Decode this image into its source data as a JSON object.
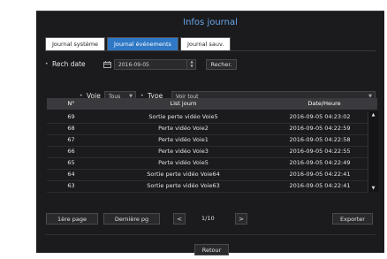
{
  "window": {
    "title": "Infos journal"
  },
  "tabs": [
    {
      "label": "Journal système",
      "active": false
    },
    {
      "label": "Journal événements",
      "active": true
    },
    {
      "label": "Journal sauv.",
      "active": false
    }
  ],
  "search": {
    "label": "Rech date",
    "date_value": "2016-09-05",
    "button_label": "Recher."
  },
  "filters": {
    "channel_label": "Voie",
    "channel_value": "Tous",
    "type_label": "Type",
    "type_value": "Voir tout"
  },
  "table": {
    "columns": [
      "N°",
      "List journ",
      "Date/Heure"
    ],
    "rows": [
      {
        "no": "69",
        "event": "Sortie perte vidéo Voie5",
        "datetime": "2016-09-05 04:23:02"
      },
      {
        "no": "68",
        "event": "Perte vidéo Voie2",
        "datetime": "2016-09-05 04:22:59"
      },
      {
        "no": "67",
        "event": "Perte vidéo Voie1",
        "datetime": "2016-09-05 04:22:58"
      },
      {
        "no": "66",
        "event": "Perte vidéo Voie3",
        "datetime": "2016-09-05 04:22:55"
      },
      {
        "no": "65",
        "event": "Perte vidéo Voie5",
        "datetime": "2016-09-05 04:22:49"
      },
      {
        "no": "64",
        "event": "Sortie perte vidéo Voie64",
        "datetime": "2016-09-05 04:22:41"
      },
      {
        "no": "63",
        "event": "Sortie perte vidéo Voie63",
        "datetime": "2016-09-05 04:22:41"
      }
    ]
  },
  "pager": {
    "first_label": "1ère page",
    "last_label": "Dernière pg",
    "page_indicator": "1/10",
    "export_label": "Exporter"
  },
  "footer": {
    "return_label": "Retour"
  },
  "colors": {
    "accent": "#2f78c6",
    "title": "#6aa8ea",
    "panel": "#1b1b1d"
  }
}
